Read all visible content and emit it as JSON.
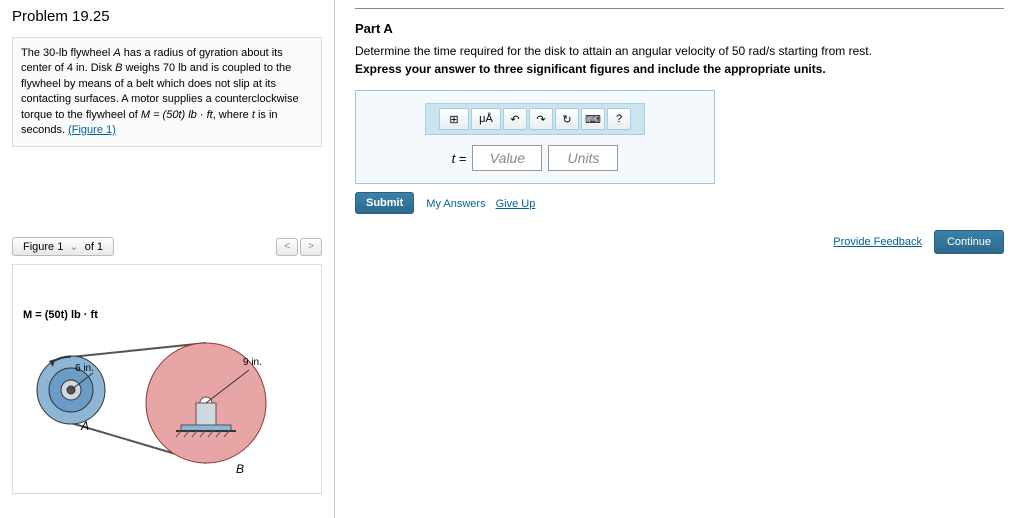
{
  "problem": {
    "title": "Problem 19.25",
    "text_prefix": "The 30-lb flywheel ",
    "text_a": "A",
    "text_mid1": " has a radius of gyration about its center of 4 in. Disk ",
    "text_b": "B",
    "text_mid2": " weighs 70 lb and is coupled to the flywheel by means of a belt which does not slip at its contacting surfaces. A motor supplies a counterclockwise torque to the flywheel of ",
    "text_m": "M = (50t) lb · ft",
    "text_mid3": ", where ",
    "text_t": "t",
    "text_mid4": " is in seconds. ",
    "figure_link": "(Figure 1)"
  },
  "figure": {
    "tab_label": "Figure 1",
    "count_label": "of 1",
    "m_label": "M = (50t) lb · ft",
    "dim1": "6 in.",
    "dim2": "9 in.",
    "label_a": "A",
    "label_b": "B"
  },
  "part": {
    "label": "Part A",
    "question": "Determine the time required for the disk to attain an angular velocity of 50 rad/s starting from rest.",
    "instruction": "Express your answer to three significant figures and include the appropriate units."
  },
  "toolbar": {
    "templates": "⊞",
    "special": "μÅ",
    "undo": "↶",
    "redo": "↷",
    "reset": "↻",
    "keyboard": "⌨",
    "help": "?"
  },
  "input": {
    "lhs": "t =",
    "value_placeholder": "Value",
    "units_placeholder": "Units"
  },
  "buttons": {
    "submit": "Submit",
    "my_answers": "My Answers",
    "give_up": "Give Up",
    "feedback": "Provide Feedback",
    "continue": "Continue"
  }
}
